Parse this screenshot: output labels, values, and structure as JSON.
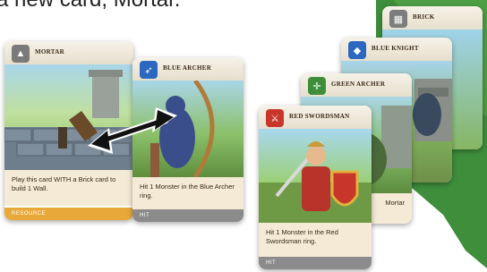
{
  "caption": "a new card, Mortar.",
  "cards": {
    "mortar": {
      "name": "MORTAR",
      "text": "Play this card WITH a Brick card to build 1 Wall.",
      "type": "RESOURCE"
    },
    "blue_archer": {
      "name": "BLUE ARCHER",
      "text": "Hit 1 Monster in the Blue Archer ring.",
      "type": "HIT"
    },
    "brick": {
      "name": "BRICK"
    },
    "blue_knight": {
      "name": "BLUE KNIGHT"
    },
    "green_archer": {
      "name": "GREEN ARCHER",
      "text": "Mortar"
    },
    "red_swordsman": {
      "name": "RED SWORDSMAN",
      "text": "Hit 1 Monster in the Red Swordsman ring.",
      "type": "HIT"
    }
  },
  "colors": {
    "resource_band": "#e9a83a",
    "hit_band": "#8b8b8b",
    "blue": "#2c67c0",
    "green": "#3f8f3a",
    "red": "#c8362b"
  }
}
